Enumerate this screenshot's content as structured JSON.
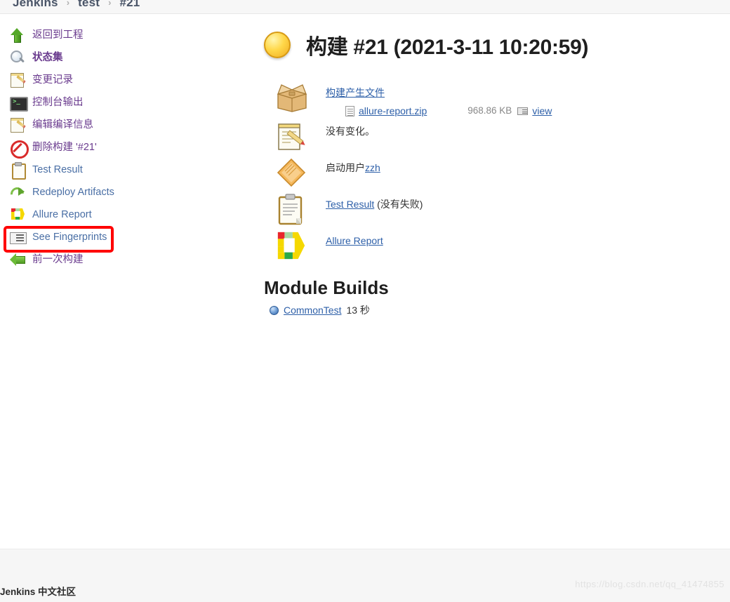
{
  "breadcrumb": {
    "items": [
      {
        "label": "Jenkins",
        "name": "breadcrumb-jenkins"
      },
      {
        "label": "test",
        "name": "breadcrumb-test"
      },
      {
        "label": "#21",
        "name": "breadcrumb-build"
      }
    ],
    "separator": "›"
  },
  "sidebar": {
    "items": [
      {
        "label": "返回到工程",
        "icon": "green-up-arrow-icon",
        "style": "visited",
        "bold": false
      },
      {
        "label": "状态集",
        "icon": "magnifier-icon",
        "style": "visited",
        "bold": true
      },
      {
        "label": "变更记录",
        "icon": "notepad-pencil-icon",
        "style": "visited",
        "bold": false
      },
      {
        "label": "控制台输出",
        "icon": "console-terminal-icon",
        "style": "visited",
        "bold": false
      },
      {
        "label": "编辑编译信息",
        "icon": "notepad-pencil-icon",
        "style": "visited",
        "bold": false
      },
      {
        "label": "删除构建 '#21'",
        "icon": "no-entry-icon",
        "style": "visited",
        "bold": false
      },
      {
        "label": "Test Result",
        "icon": "clipboard-icon",
        "style": "blue",
        "bold": false
      },
      {
        "label": "Redeploy Artifacts",
        "icon": "redeploy-arrow-icon",
        "style": "blue",
        "bold": false
      },
      {
        "label": "Allure Report",
        "icon": "allure-logo-icon",
        "style": "blue",
        "bold": false
      },
      {
        "label": "See Fingerprints",
        "icon": "fingerprint-card-icon",
        "style": "blue",
        "bold": false
      },
      {
        "label": "前一次构建",
        "icon": "green-left-arrow-icon",
        "style": "visited",
        "bold": false
      }
    ],
    "annotation": {
      "color": "#ff0000",
      "target": "Allure Report"
    }
  },
  "main": {
    "build": {
      "status_icon": "yellow-ball-icon",
      "title": "构建 #21 (2021-3-11 10:20:59)"
    },
    "rows": {
      "artifacts": {
        "icon": "package-box-icon",
        "link": "构建产生文件",
        "file_name": "allure-report.zip",
        "file_size": "968.86 KB",
        "view_label": "view"
      },
      "changes": {
        "icon": "notepad-pencil-icon",
        "text": "没有变化。"
      },
      "started_by": {
        "icon": "orange-diamond-icon",
        "prefix": "启动用户",
        "user": "zzh"
      },
      "test_result": {
        "icon": "clipboard-icon",
        "link": "Test Result",
        "suffix": "(没有失败)"
      },
      "allure": {
        "icon": "allure-logo-icon",
        "link": "Allure Report"
      }
    },
    "module_builds": {
      "heading": "Module Builds",
      "items": [
        {
          "icon": "blue-ball-icon",
          "name": "CommonTest",
          "duration": "13 秒"
        }
      ]
    }
  },
  "footer": {
    "text": "Jenkins 中文社区",
    "watermark": "https://blog.csdn.net/qq_41474855"
  }
}
